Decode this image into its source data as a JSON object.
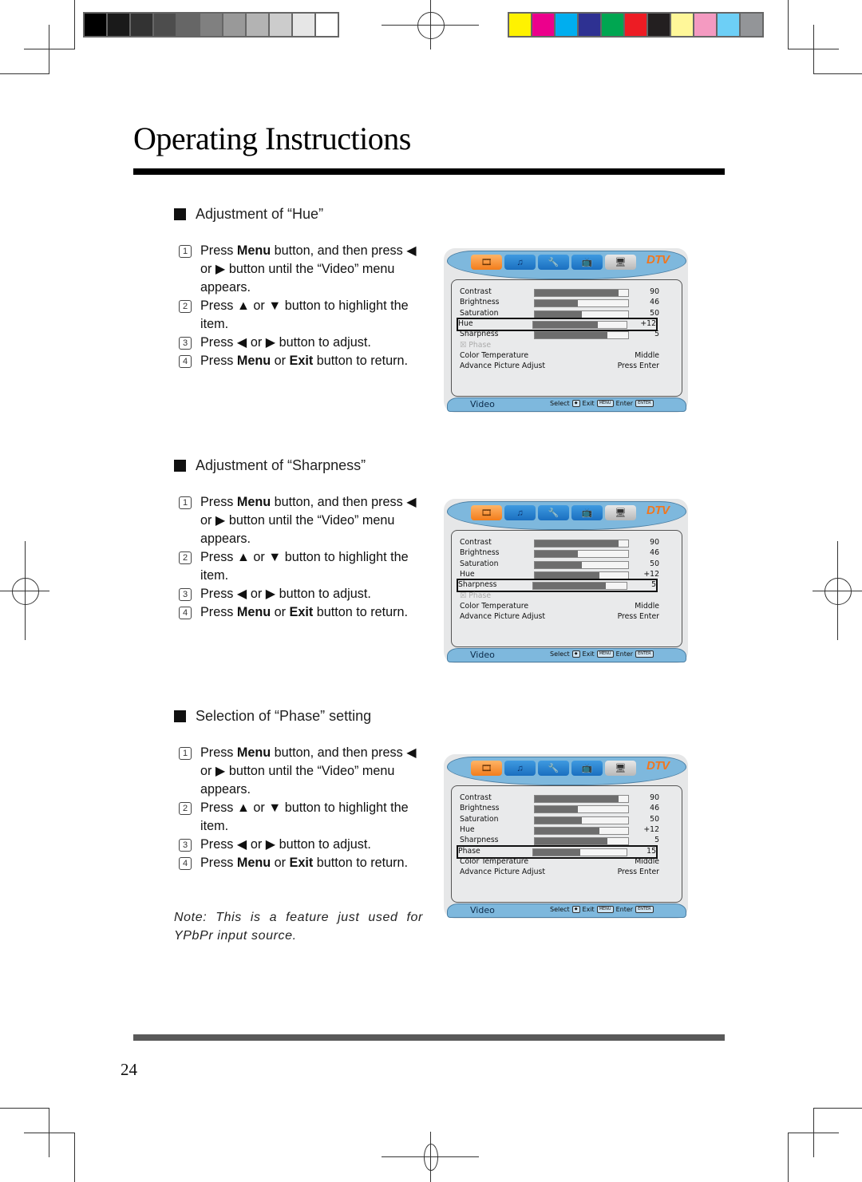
{
  "print_marks": {
    "grayscale_swatches": [
      "#000000",
      "#1a1a1a",
      "#333333",
      "#4d4d4d",
      "#666666",
      "#808080",
      "#999999",
      "#b3b3b3",
      "#cccccc",
      "#e6e6e6",
      "#ffffff"
    ],
    "color_swatches": [
      "#fff200",
      "#ec008c",
      "#00aeef",
      "#2e3192",
      "#00a651",
      "#ed1c24",
      "#231f20",
      "#fff799",
      "#f49ac1",
      "#6dcff6",
      "#939598"
    ]
  },
  "page": {
    "title": "Operating Instructions",
    "page_number": "24"
  },
  "sections": [
    {
      "heading": "Adjustment of “Hue”",
      "steps": [
        {
          "num": "1",
          "parts": [
            [
              "Press ",
              0
            ],
            [
              "Menu",
              1
            ],
            [
              " button, and then press ◀ or ▶ button until the “Video” menu appears.",
              0
            ]
          ]
        },
        {
          "num": "2",
          "parts": [
            [
              "Press ▲ or ▼ button to highlight the item.",
              0
            ]
          ]
        },
        {
          "num": "3",
          "parts": [
            [
              "Press ◀ or ▶ button to adjust.",
              0
            ]
          ]
        },
        {
          "num": "4",
          "parts": [
            [
              "Press ",
              0
            ],
            [
              "Menu",
              1
            ],
            [
              " or ",
              0
            ],
            [
              "Exit",
              1
            ],
            [
              " button to return.",
              0
            ]
          ]
        }
      ],
      "osd": {
        "selected_row": 3,
        "phase_enabled": false
      }
    },
    {
      "heading": "Adjustment of “Sharpness”",
      "steps": [
        {
          "num": "1",
          "parts": [
            [
              "Press ",
              0
            ],
            [
              "Menu",
              1
            ],
            [
              " button, and then press ◀ or ▶ button until the “Video” menu appears.",
              0
            ]
          ]
        },
        {
          "num": "2",
          "parts": [
            [
              "Press ▲ or ▼ button to highlight the item.",
              0
            ]
          ]
        },
        {
          "num": "3",
          "parts": [
            [
              "Press ◀ or ▶ button to adjust.",
              0
            ]
          ]
        },
        {
          "num": "4",
          "parts": [
            [
              "Press ",
              0
            ],
            [
              "Menu",
              1
            ],
            [
              " or ",
              0
            ],
            [
              "Exit",
              1
            ],
            [
              " button to return.",
              0
            ]
          ]
        }
      ],
      "osd": {
        "selected_row": 4,
        "phase_enabled": false
      }
    },
    {
      "heading": "Selection of “Phase” setting",
      "steps": [
        {
          "num": "1",
          "parts": [
            [
              "Press ",
              0
            ],
            [
              "Menu",
              1
            ],
            [
              " button, and then press ◀ or ▶ button until the “Video” menu appears.",
              0
            ]
          ]
        },
        {
          "num": "2",
          "parts": [
            [
              "Press ▲ or ▼ button to highlight the item.",
              0
            ]
          ]
        },
        {
          "num": "3",
          "parts": [
            [
              "Press ◀ or ▶ button to adjust.",
              0
            ]
          ]
        },
        {
          "num": "4",
          "parts": [
            [
              "Press ",
              0
            ],
            [
              "Menu",
              1
            ],
            [
              " or ",
              0
            ],
            [
              "Exit",
              1
            ],
            [
              " button to return.",
              0
            ]
          ]
        }
      ],
      "osd": {
        "selected_row": 5,
        "phase_enabled": true
      },
      "note": "Note: This is a feature just used for YPbPr input source."
    }
  ],
  "osd_common": {
    "tabs": [
      {
        "icon": "film-icon",
        "glyph": "🎞",
        "active": true
      },
      {
        "icon": "music-icon",
        "glyph": "♫",
        "active": false
      },
      {
        "icon": "wrench-icon",
        "glyph": "🔧",
        "active": false
      },
      {
        "icon": "tv-icon",
        "glyph": "📺",
        "active": false
      },
      {
        "icon": "monitor-icon",
        "glyph": "🖥",
        "active": false
      }
    ],
    "dtv_label": "DTV",
    "rows": [
      {
        "label": "Contrast",
        "value": "90",
        "fill": 0.9,
        "bar": true
      },
      {
        "label": "Brightness",
        "value": "46",
        "fill": 0.46,
        "bar": true
      },
      {
        "label": "Saturation",
        "value": "50",
        "fill": 0.5,
        "bar": true
      },
      {
        "label": "Hue",
        "value": "+12",
        "fill": 0.69,
        "bar": true
      },
      {
        "label": "Sharpness",
        "value": "5",
        "fill": 0.78,
        "bar": true
      },
      {
        "label": "Phase",
        "value": "15",
        "fill": 0.5,
        "bar": true
      },
      {
        "label": "Color Temperature",
        "value": "Middle",
        "bar": false
      },
      {
        "label": "Advance Picture Adjust",
        "value": "Press Enter",
        "bar": false
      }
    ],
    "menu_name": "Video",
    "hints": {
      "select": "Select",
      "exit": "Exit",
      "enter": "Enter",
      "menu_key": "MENU",
      "enter_key": "ENTER"
    }
  }
}
